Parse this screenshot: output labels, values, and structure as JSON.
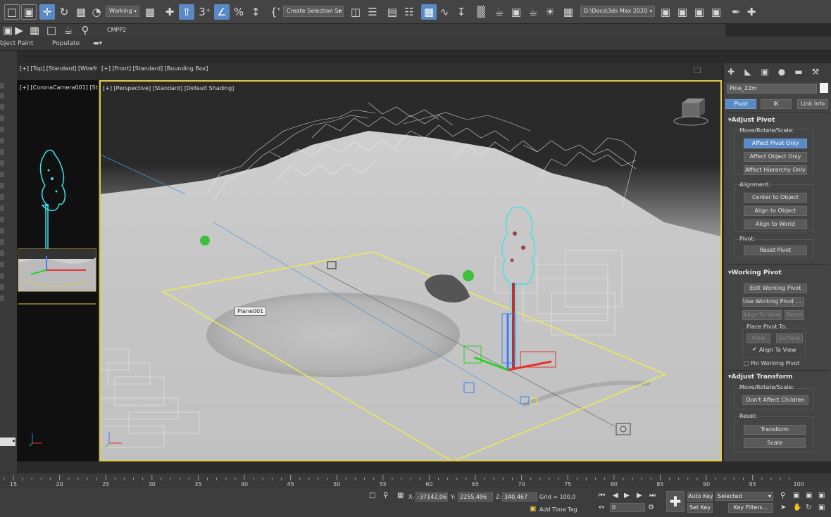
{
  "toolbar": {
    "selection_set_dropdown": "Working",
    "named_selection_dropdown": "Create Selection Se",
    "project_path": "D:\\Docs\\3ds Max 2020",
    "icons": [
      "select-icon",
      "region-select-icon",
      "move-icon",
      "rotate-icon",
      "scale-icon",
      "snap-icon",
      "angle-snap-icon",
      "percent-snap-icon",
      "spinner-snap-icon",
      "edit-named-selection-icon",
      "mirror-icon",
      "align-icon",
      "layer-explorer-icon",
      "toggle-ribbon-icon",
      "curve-editor-icon",
      "schematic-view-icon",
      "material-editor-icon",
      "render-setup-icon",
      "render-frame-icon",
      "render-icon"
    ]
  },
  "secondary_toolbar": {
    "label": "CMPP2"
  },
  "ribbon_tabs": {
    "object_paint": "bject Paint",
    "populate": "Populate"
  },
  "viewports": {
    "top_label": "[+] [Top] [Standard] [Wirefr",
    "front_label": "[+] [Front] [Standard] [Bounding Box]",
    "camera_label": "[+] [CoronaCamera001] [Sta",
    "perspective_label": "[+] [Perspective] [Standard] [Default Shading]",
    "plane_tooltip": "Plane001"
  },
  "command_panel": {
    "object_name": "Pine_22m",
    "tabs": {
      "pivot": "Pivot",
      "ik": "IK",
      "link_info": "Link Info"
    },
    "adjust_pivot": {
      "title": "Adjust Pivot",
      "move_rotate_scale": "Move/Rotate/Scale:",
      "affect_pivot_only": "Affect Pivot Only",
      "affect_object_only": "Affect Object Only",
      "affect_hierarchy_only": "Affect Hierarchy Only",
      "alignment": "Alignment:",
      "center_to_object": "Center to Object",
      "align_to_object": "Align to Object",
      "align_to_world": "Align to World",
      "pivot": "Pivot:",
      "reset_pivot": "Reset Pivot"
    },
    "working_pivot": {
      "title": "Working Pivot",
      "edit_working_pivot": "Edit Working Pivot",
      "use_working_pivot": "Use Working Pivot",
      "ellipsis": "...",
      "align_to_view": "Align To View",
      "reset": "Reset",
      "place_pivot_to": "Place Pivot To:",
      "view": "View",
      "surface": "Surface",
      "align_to_view_check": "Align To View",
      "pin_working_pivot": "Pin Working Pivot"
    },
    "adjust_transform": {
      "title": "Adjust Transform",
      "move_rotate_scale": "Move/Rotate/Scale:",
      "dont_affect_children": "Don't Affect Children",
      "reset": "Reset:",
      "transform": "Transform",
      "scale": "Scale"
    }
  },
  "timeline": {
    "ticks": [
      "15",
      "20",
      "25",
      "30",
      "35",
      "40",
      "45",
      "50",
      "55",
      "60",
      "65",
      "70",
      "75",
      "80",
      "85",
      "90",
      "95",
      "100"
    ]
  },
  "status": {
    "x_label": "X:",
    "x_value": "-37142,06",
    "y_label": "Y:",
    "y_value": "2255,496",
    "z_label": "Z:",
    "z_value": "340,467",
    "grid": "Grid = 100,0",
    "add_time_tag": "Add Time Tag",
    "current_frame": "0",
    "auto_key": "Auto Key",
    "set_key": "Set Key",
    "key_mode": "Selected",
    "key_filters": "Key Filters..."
  },
  "colors": {
    "selection_accent": "#5a8ac6",
    "active_viewport_border": "#e2c84a",
    "selected_tree": "#3fe0f0"
  }
}
